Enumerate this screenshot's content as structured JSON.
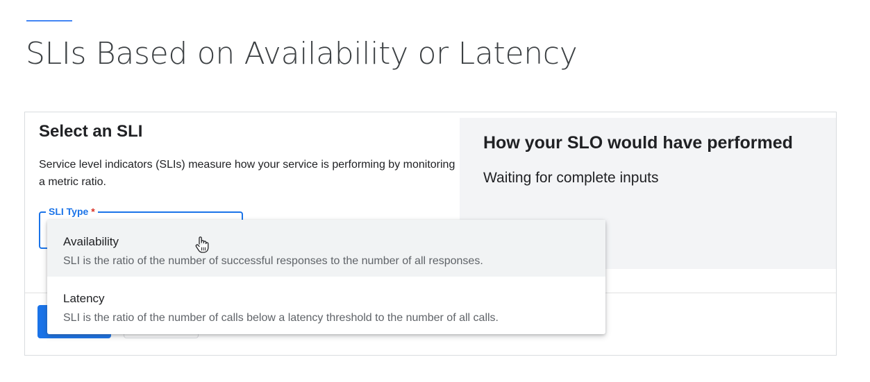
{
  "slide": {
    "title": "SLIs Based on Availability or Latency",
    "accent_color": "#4285f4"
  },
  "form": {
    "title": "Select an SLI",
    "description": "Service level indicators (SLIs) measure how your service is performing by monitoring a metric ratio.",
    "sli_type": {
      "label": "SLI Type",
      "required_marker": "*",
      "value": ""
    },
    "buttons": {
      "primary_label": "",
      "secondary_label": ""
    }
  },
  "preview": {
    "title": "How your SLO would have performed",
    "status": "Waiting for complete inputs"
  },
  "dropdown": {
    "options": [
      {
        "name": "Availability",
        "description": "SLI is the ratio of the number of successful responses to the number of all responses.",
        "hovered": true
      },
      {
        "name": "Latency",
        "description": "SLI is the ratio of the number of calls below a latency threshold to the number of all calls.",
        "hovered": false
      }
    ]
  },
  "cursor": {
    "icon": "hand-pointer-icon"
  },
  "colors": {
    "primary": "#1a73e8",
    "required": "#d93025",
    "panel_bg": "#f3f4f6"
  }
}
